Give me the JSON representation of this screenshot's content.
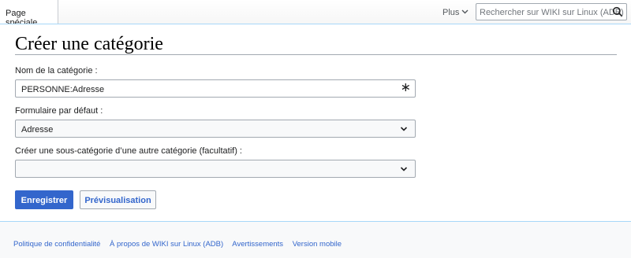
{
  "tabs": {
    "special_page": "Page spéciale"
  },
  "header": {
    "more_label": "Plus",
    "search_placeholder": "Rechercher sur WIKI sur Linux (ADB)"
  },
  "page": {
    "title": "Créer une catégorie"
  },
  "form": {
    "category_name_label": "Nom de la catégorie :",
    "category_name_value": "PERSONNE:Adresse",
    "required_marker": "∗",
    "default_form_label": "Formulaire par défaut :",
    "default_form_value": "Adresse",
    "subcategory_label": "Créer une sous-catégorie d’une autre catégorie (facultatif) :",
    "subcategory_value": ""
  },
  "buttons": {
    "save": "Enregistrer",
    "preview": "Prévisualisation"
  },
  "footer": {
    "links": [
      "Politique de confidentialité",
      "À propos de WIKI sur Linux (ADB)",
      "Avertissements",
      "Version mobile"
    ]
  },
  "icons": {
    "search": "search-icon",
    "more": "chevron-down-icon",
    "select": "chevron-down-icon"
  },
  "colors": {
    "accent": "#3366cc",
    "border": "#a2a9b1"
  }
}
